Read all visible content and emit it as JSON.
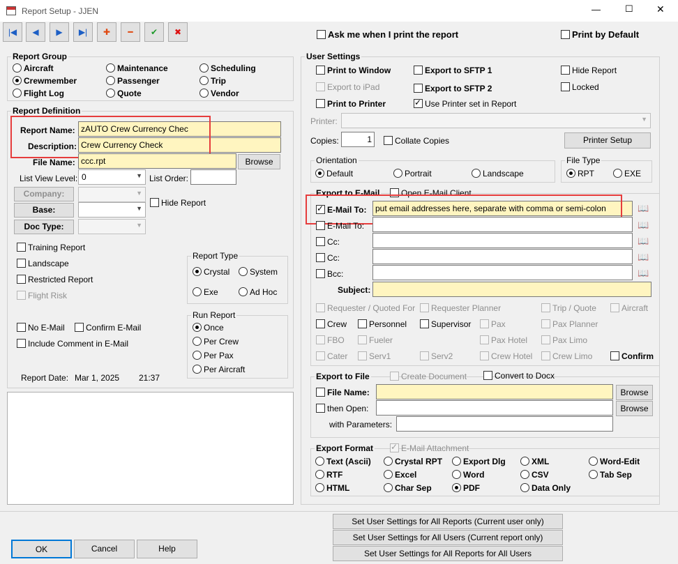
{
  "window": {
    "title": "Report Setup - JJEN",
    "minimize": "—",
    "maximize": "☐",
    "close": "✕"
  },
  "toolbar": {
    "first": "|◀",
    "prev": "◀",
    "next": "▶",
    "last": "▶|",
    "add": "✚",
    "remove": "━",
    "accept": "✔",
    "cancel": "✖",
    "ask_print": "Ask me when I print the report",
    "print_default": "Print by Default"
  },
  "report_group": {
    "title": "Report Group",
    "aircraft": "Aircraft",
    "maintenance": "Maintenance",
    "scheduling": "Scheduling",
    "crewmember": "Crewmember",
    "passenger": "Passenger",
    "trip": "Trip",
    "flight_log": "Flight Log",
    "quote": "Quote",
    "vendor": "Vendor"
  },
  "report_def": {
    "title": "Report Definition",
    "report_name_label": "Report Name:",
    "report_name": "zAUTO Crew Currency Chec",
    "description_label": "Description:",
    "description": "Crew Currency Check",
    "file_name_label": "File Name:",
    "file_name": "ccc.rpt",
    "browse": "Browse",
    "list_view_label": "List View Level:",
    "list_view_value": "0",
    "list_order_label": "List Order:",
    "company": "Company:",
    "base": "Base:",
    "doc_type": "Doc Type:",
    "hide_report": "Hide Report",
    "training": "Training Report",
    "landscape": "Landscape",
    "restricted": "Restricted Report",
    "flight_risk": "Flight Risk",
    "no_email": "No E-Mail",
    "confirm_email": "Confirm E-Mail",
    "include_comment": "Include Comment in E-Mail",
    "report_date_label": "Report Date:",
    "report_date": "Mar 1, 2025",
    "report_time": "21:37"
  },
  "report_type": {
    "title": "Report Type",
    "crystal": "Crystal",
    "system": "System",
    "exe": "Exe",
    "adhoc": "Ad Hoc"
  },
  "run_report": {
    "title": "Run Report",
    "once": "Once",
    "per_crew": "Per Crew",
    "per_pax": "Per Pax",
    "per_aircraft": "Per Aircraft"
  },
  "user_settings": {
    "title": "User Settings",
    "print_window": "Print to Window",
    "export_sftp1": "Export to SFTP 1",
    "hide_report": "Hide Report",
    "export_ipad": "Export to iPad",
    "export_sftp2": "Export to SFTP 2",
    "locked": "Locked",
    "print_printer": "Print to Printer",
    "use_printer_set": "Use Printer set in Report",
    "printer_label": "Printer:",
    "copies_label": "Copies:",
    "copies": "1",
    "collate": "Collate Copies",
    "printer_setup": "Printer Setup"
  },
  "orientation": {
    "title": "Orientation",
    "default": "Default",
    "portrait": "Portrait",
    "landscape": "Landscape"
  },
  "file_type": {
    "title": "File Type",
    "rpt": "RPT",
    "exe": "EXE"
  },
  "export_email": {
    "title": "Export to E-Mail",
    "open_client": "Open E-Mail Client",
    "email_to": "E-Mail To:",
    "email_to_value": "put email addresses here, separate with comma or semi-colon",
    "email_to2": "E-Mail To:",
    "cc": "Cc:",
    "cc2": "Cc:",
    "bcc": "Bcc:",
    "subject": "Subject:",
    "requester_quoted": "Requester / Quoted For",
    "requester_planner": "Requester Planner",
    "trip_quote": "Trip / Quote",
    "aircraft": "Aircraft",
    "crew": "Crew",
    "personnel": "Personnel",
    "supervisor": "Supervisor",
    "pax": "Pax",
    "pax_planner": "Pax Planner",
    "fbo": "FBO",
    "fueler": "Fueler",
    "pax_hotel": "Pax Hotel",
    "pax_limo": "Pax Limo",
    "cater": "Cater",
    "serv1": "Serv1",
    "serv2": "Serv2",
    "crew_hotel": "Crew Hotel",
    "crew_limo": "Crew Limo",
    "confirm": "Confirm"
  },
  "export_file": {
    "title": "Export to File",
    "create_doc": "Create Document",
    "convert_docx": "Convert to Docx",
    "file_name": "File Name:",
    "browse1": "Browse",
    "then_open": "then Open:",
    "browse2": "Browse",
    "with_params": "with Parameters:"
  },
  "export_format": {
    "title": "Export Format",
    "email_attach": "E-Mail Attachment",
    "text": "Text (Ascii)",
    "crystal_rpt": "Crystal RPT",
    "export_dlg": "Export Dlg",
    "xml": "XML",
    "word_edit": "Word-Edit",
    "rtf": "RTF",
    "excel": "Excel",
    "word": "Word",
    "csv": "CSV",
    "tab_sep": "Tab Sep",
    "html": "HTML",
    "char_sep": "Char Sep",
    "pdf": "PDF",
    "data_only": "Data Only"
  },
  "footer": {
    "ok": "OK",
    "cancel": "Cancel",
    "help": "Help",
    "set_all_reports": "Set User Settings for All Reports (Current user only)",
    "set_all_users": "Set User Settings for All Users (Current report only)",
    "set_all_both": "Set User Settings for All Reports for All Users"
  },
  "icons": {
    "app": "calendar-icon",
    "book": "address-book-icon"
  }
}
